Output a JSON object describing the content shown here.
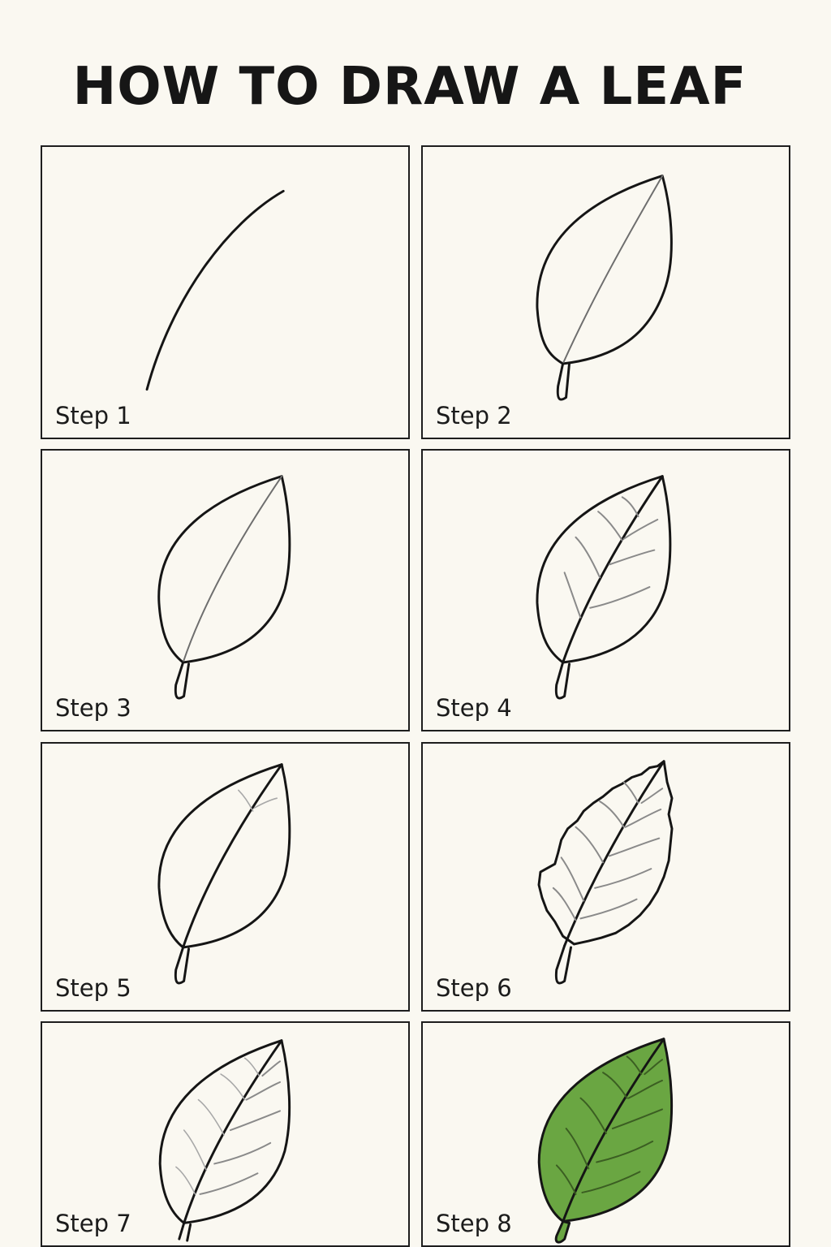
{
  "title": "HOW TO DRAW A LEAF",
  "steps": [
    {
      "label": "Step 1"
    },
    {
      "label": "Step 2"
    },
    {
      "label": "Step 3"
    },
    {
      "label": "Step 4"
    },
    {
      "label": "Step 5"
    },
    {
      "label": "Step 6"
    },
    {
      "label": "Step 7"
    },
    {
      "label": "Step 8"
    }
  ],
  "colors": {
    "background": "#faf8f1",
    "outline": "#151515",
    "leaf_fill": "#6aa642"
  }
}
